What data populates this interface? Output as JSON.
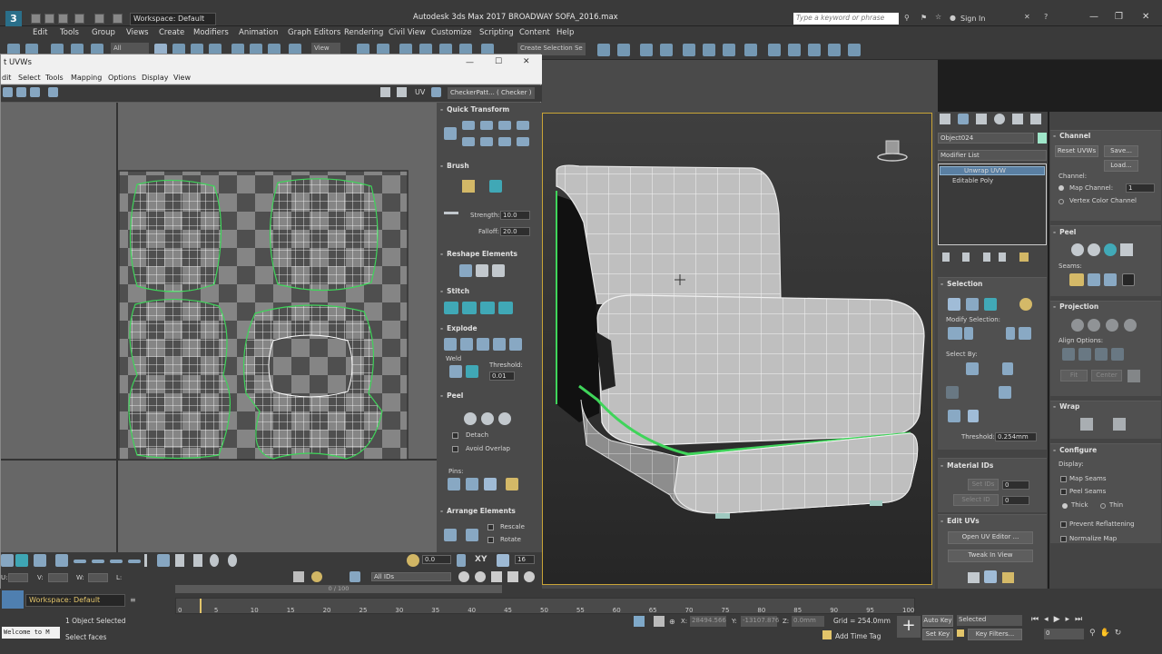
{
  "title_bar": {
    "logo": "3",
    "workspace": "Workspace: Default",
    "app_title": "Autodesk 3ds Max 2017    BROADWAY SOFA_2016.max",
    "search_placeholder": "Type a keyword or phrase",
    "signin": "Sign In"
  },
  "menu": [
    "Edit",
    "Tools",
    "Group",
    "Views",
    "Create",
    "Modifiers",
    "Animation",
    "Graph Editors",
    "Rendering",
    "Civil View",
    "Customize",
    "Scripting",
    "Content",
    "Help"
  ],
  "toolbar": {
    "filter": "All",
    "view": "View",
    "selection_set": "Create Selection Se"
  },
  "uv_editor": {
    "title": "t UVWs",
    "menu": [
      "dit",
      "Select",
      "Tools",
      "Mapping",
      "Options",
      "Display",
      "View"
    ],
    "uv_label": "UV",
    "checker": "CheckerPatt... ( Checker )",
    "quick_transform": "Quick Transform",
    "brush": "Brush",
    "strength_label": "Strength:",
    "strength": "10.0",
    "falloff_label": "Falloff:",
    "falloff": "20.0",
    "reshape": "Reshape Elements",
    "stitch": "Stitch",
    "explode": "Explode",
    "weld": "Weld",
    "threshold_label": "Threshold:",
    "threshold": "0.01",
    "peel": "Peel",
    "detach": "Detach",
    "avoid_overlap": "Avoid Overlap",
    "pins": "Pins:",
    "arrange": "Arrange Elements",
    "rescale": "Rescale",
    "rotate": "Rotate",
    "spin_value": "0.0",
    "xy": "XY",
    "grid_value": "16",
    "u_label": "U:",
    "v_label": "V:",
    "w_label": "W:",
    "l_label": "L:",
    "all_ids": "All IDs"
  },
  "command_panel": {
    "object_name": "Object024",
    "modifier_list": "Modifier List",
    "stack": [
      "Unwrap UVW",
      "Editable Poly"
    ],
    "selection": "Selection",
    "modify_selection": "Modify Selection:",
    "select_by": "Select By:",
    "threshold_label": "Threshold:",
    "threshold": "0.254mm",
    "material_ids": "Material IDs",
    "set_ids": "Set IDs",
    "select_id": "Select ID",
    "zero1": "0",
    "zero2": "0",
    "edit_uvs": "Edit UVs",
    "open_uv_editor": "Open UV Editor ...",
    "tweak_in_view": "Tweak In View"
  },
  "right_panel": {
    "channel": "Channel",
    "reset_uvws": "Reset UVWs",
    "save": "Save...",
    "load": "Load...",
    "channel_label": "Channel:",
    "map_channel": "Map Channel:",
    "map_channel_value": "1",
    "vertex_color_channel": "Vertex Color Channel",
    "peel": "Peel",
    "seams": "Seams:",
    "projection": "Projection",
    "align_options": "Align Options:",
    "fit": "Fit",
    "center": "Center",
    "wrap": "Wrap",
    "configure": "Configure",
    "display": "Display:",
    "map_seams": "Map Seams",
    "peel_seams": "Peel Seams",
    "thick": "Thick",
    "thin": "Thin",
    "prevent_reflattening": "Prevent Reflattening",
    "normalize_map": "Normalize Map"
  },
  "status": {
    "workspace": "Workspace: Default",
    "welcome": "Welcome to M",
    "objects_selected": "1 Object Selected",
    "select_faces": "Select faces",
    "time": "0 / 100",
    "ticks": [
      "0",
      "5",
      "10",
      "15",
      "20",
      "25",
      "30",
      "35",
      "40",
      "45",
      "50",
      "55",
      "60",
      "65",
      "70",
      "75",
      "80",
      "85",
      "90",
      "95",
      "100"
    ],
    "x_label": "X:",
    "x": "28494.566",
    "y_label": "Y:",
    "y": "-13107.876",
    "z_label": "Z:",
    "z": "0.0mm",
    "grid": "Grid = 254.0mm",
    "add_time_tag": "Add Time Tag",
    "auto_key": "Auto Key",
    "selected": "Selected",
    "set_key": "Set Key",
    "key_filters": "Key Filters...",
    "frame": "0"
  },
  "colors": {
    "accent_blue": "#7fa9c9",
    "selection_border": "#c9a437",
    "seam_green": "#3fd45a",
    "checker_dark": "#4f4f4f",
    "checker_light": "#858585"
  }
}
